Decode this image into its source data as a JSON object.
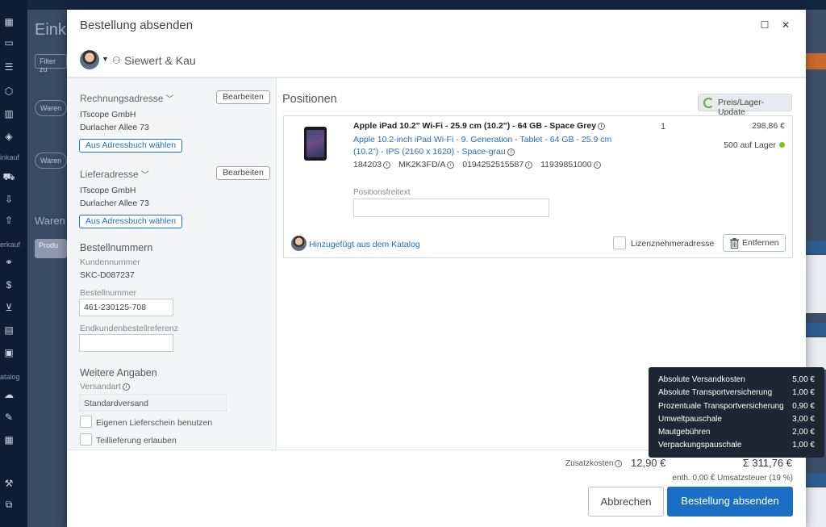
{
  "background": {
    "page_title": "Einka",
    "filter_label": "Filter zu",
    "chip_label": "Waren",
    "section_label": "Waren",
    "product_button": "Produ",
    "sidebar_labels": [
      "inkauf",
      "erkauf",
      "atalog"
    ],
    "accent_orange": "#c76a2b"
  },
  "modal": {
    "title": "Bestellung absenden",
    "supplier_name": "Siewert & Kau",
    "billing": {
      "label": "Rechnungsadresse",
      "edit_label": "Bearbeiten",
      "company": "ITscope GmbH",
      "street": "Durlacher Allee 73",
      "addressbook_label": "Aus Adressbuch wählen"
    },
    "delivery": {
      "label": "Lieferadresse",
      "edit_label": "Bearbeiten",
      "company": "ITscope GmbH",
      "street": "Durlacher Allee 73",
      "addressbook_label": "Aus Adressbuch wählen"
    },
    "order_numbers": {
      "heading": "Bestellnummern",
      "customer_number_label": "Kundennummer",
      "customer_number": "SKC-D087237",
      "order_number_label": "Bestellnummer",
      "order_number": "461-230125-708",
      "end_customer_ref_label": "Endkundenbestellreferenz",
      "end_customer_ref": ""
    },
    "more": {
      "heading": "Weitere Angaben",
      "shipping_type_label": "Versandart",
      "shipping_type": "Standardversand",
      "own_delivery_note_label": "Eigenen Lieferschein benutzen",
      "partial_delivery_label": "Teillieferung erlauben"
    },
    "positions": {
      "title": "Positionen",
      "update_button": "Preis/Lager-Update",
      "item": {
        "name": "Apple iPad 10.2\" Wi-Fi - 25.9 cm (10.2\") - 64 GB - Space Grey",
        "description": "Apple 10.2-inch iPad Wi-Fi - 9. Generation - Tablet - 64 GB - 25.9 cm (10.2\") - IPS (2160 x 1620) - Space-grau",
        "codes": [
          "184203",
          "MK2K3FD/A",
          "0194252515587",
          "11939851000"
        ],
        "quantity": "1",
        "price": "298,86 €",
        "stock": "500 auf Lager",
        "stock_color": "#7fc41c",
        "freetext_label": "Positionsfreitext",
        "freetext": "",
        "added_from": "Hinzugefügt aus dem Katalog",
        "licensee_label": "Lizenznehmeradresse",
        "remove_label": "Entfernen"
      }
    },
    "footer": {
      "extra_costs_label": "Zusatzkosten",
      "extra_costs": "12,90 €",
      "total": "Σ 311,76 €",
      "tax_note": "enth. 0,00 € Umsatzsteuer (19 %)",
      "cancel_label": "Abbrechen",
      "submit_label": "Bestellung absenden",
      "submit_color": "#1a6fc4"
    },
    "cost_breakdown": [
      {
        "name": "Absolute Versandkosten",
        "value": "5,00 €"
      },
      {
        "name": "Absolute Transportversicherung",
        "value": "1,00 €"
      },
      {
        "name": "Prozentuale Transportversicherung",
        "value": "0,90 €"
      },
      {
        "name": "Umweltpauschale",
        "value": "3,00 €"
      },
      {
        "name": "Mautgebühren",
        "value": "2,00 €"
      },
      {
        "name": "Verpackungspauschale",
        "value": "1,00 €"
      }
    ]
  }
}
